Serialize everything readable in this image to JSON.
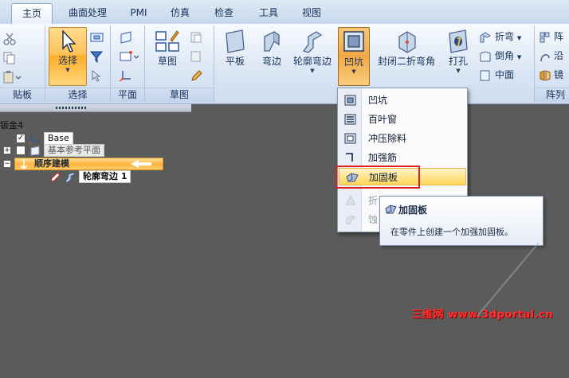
{
  "tabs": [
    {
      "label": "主页",
      "active": true
    },
    {
      "label": "曲面处理"
    },
    {
      "label": "PMI"
    },
    {
      "label": "仿真"
    },
    {
      "label": "检查"
    },
    {
      "label": "工具"
    },
    {
      "label": "视图"
    }
  ],
  "ribbon": {
    "clipboard": {
      "label": "贴板"
    },
    "select": {
      "button": "选择",
      "label": "选择"
    },
    "plane": {
      "label": "平面"
    },
    "sketch": {
      "button": "草图",
      "label": "草图"
    },
    "sheetmetal": {
      "flat": "平板",
      "flange": "弯边",
      "contour_flange": "轮廓弯边",
      "dimple": "凹坑",
      "closed_corner": "封闭二折弯角",
      "hole": "打孔",
      "bend": "折弯",
      "chamfer": "倒角",
      "midplane": "中面"
    },
    "pattern": {
      "label": "阵列",
      "item1": "阵",
      "item2": "沿",
      "item3": "镜"
    }
  },
  "tree": {
    "root": "钣金4",
    "base": "Base",
    "ref_planes": "基本参考平面",
    "sequence": "顺序建模",
    "feature": "轮廓弯边 1"
  },
  "dropdown": {
    "items": [
      {
        "label": "凹坑",
        "icon": "dimple-icon"
      },
      {
        "label": "百叶窗",
        "icon": "louver-icon"
      },
      {
        "label": "冲压除料",
        "icon": "punch-icon"
      },
      {
        "label": "加强筋",
        "icon": "bead-icon"
      },
      {
        "label": "加固板",
        "icon": "gusset-icon",
        "hover": true
      },
      {
        "label": "折",
        "icon": "fold-icon",
        "disabled": true
      },
      {
        "label": "蚀",
        "icon": "etch-icon",
        "disabled": true
      }
    ]
  },
  "tooltip": {
    "title": "加固板",
    "body": "在零件上创建一个加强加固板。"
  },
  "watermark": "三维网 www.3dportal.cn",
  "colors": {
    "highlight": "#ffc35a",
    "ribbon": "#dbe6f4",
    "viewport": "#5b5b5b",
    "callout": "#e02020"
  }
}
